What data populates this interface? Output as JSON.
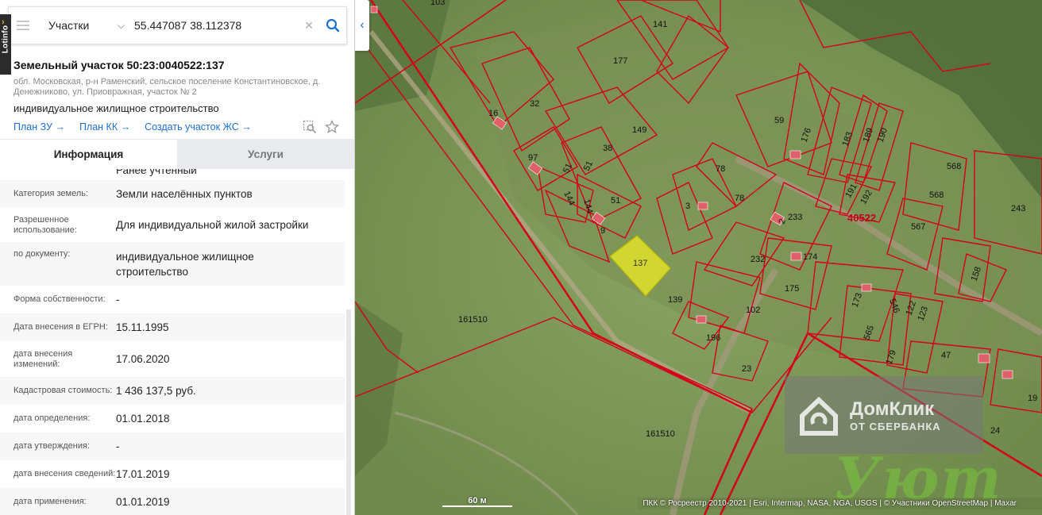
{
  "plugin": {
    "name": "Lotinfo"
  },
  "search": {
    "layer": "Участки",
    "query": "55.447087 38.112378",
    "clear": "×"
  },
  "plot": {
    "title": "Земельный участок 50:23:0040522:137",
    "address": "обл. Московская, р-н Раменский, сельское поселение Константиновское, д. Денежниково, ул. Приовражная, участок № 2",
    "purpose": "индивидуальное жилищное строительство"
  },
  "links": [
    "План ЗУ →",
    "План КК →",
    "Создать участок ЖС →"
  ],
  "tabs": {
    "info": "Информация",
    "services": "Услуги"
  },
  "info": {
    "cut_value": "Ранее учтенный",
    "rows": [
      {
        "key": "Категория земель:",
        "value": "Земли населённых пунктов"
      },
      {
        "key": "Разрешенное использование:",
        "value": "Для индивидуальной жилой застройки"
      },
      {
        "key": "по документу:",
        "value": "индивидуальное жилищное строительство"
      },
      {
        "key": "Форма собственности:",
        "value": "-"
      },
      {
        "key": "Дата внесения в ЕГРН:",
        "value": "15.11.1995"
      },
      {
        "key": "дата внесения изменений:",
        "value": "17.06.2020"
      },
      {
        "key": "Кадастровая стоимость:",
        "value": "1 436 137,5 руб."
      },
      {
        "key": "дата определения:",
        "value": "01.01.2018"
      },
      {
        "key": "дата утверждения:",
        "value": "-"
      },
      {
        "key": "дата внесения сведений:",
        "value": "17.01.2019"
      },
      {
        "key": "дата применения:",
        "value": "01.01.2019"
      }
    ]
  },
  "map": {
    "scale": "60 м",
    "attribution": "ПКК © Росреестр 2010-2021 | Esri, Intermap, NASA, NGA, USGS | © Участники OpenStreetMap | Maxar",
    "watermark_brand": "ДомКлик",
    "watermark_sub": "ОТ СБЕРБАНКА",
    "watermark_uyut": "Уют",
    "labels": {
      "selected": "137",
      "quarter": "40522",
      "big1": "161510",
      "big2": "161510",
      "p103": "103",
      "p141": "141",
      "p177": "177",
      "p16": "16",
      "p32": "32",
      "p149": "149",
      "p38": "38",
      "p97": "97",
      "p51a": "51",
      "p51b": "51",
      "p51c": "51",
      "p144a": "144",
      "p144b": "144",
      "p9": "9",
      "p3": "3",
      "p78a": "78",
      "p78b": "78",
      "p59": "59",
      "p176": "176",
      "p183": "183",
      "p189": "189",
      "p190": "190",
      "p191": "191",
      "p192": "192",
      "p568a": "568",
      "p568b": "568",
      "p243": "243",
      "p233": "233",
      "p2": "2",
      "p567": "567",
      "p232": "232",
      "p174": "174",
      "p139": "139",
      "p175": "175",
      "p102": "102",
      "p173": "173",
      "p546": "546",
      "p158": "158",
      "p196": "196",
      "p565": "565",
      "p122": "122",
      "p123": "123",
      "p179": "179",
      "p47": "47",
      "p23": "23",
      "p19": "19",
      "p24": "24"
    }
  },
  "colors": {
    "accent": "#1e6fd0",
    "boundary": "#d4001a",
    "selected_fill": "#e6e627"
  }
}
